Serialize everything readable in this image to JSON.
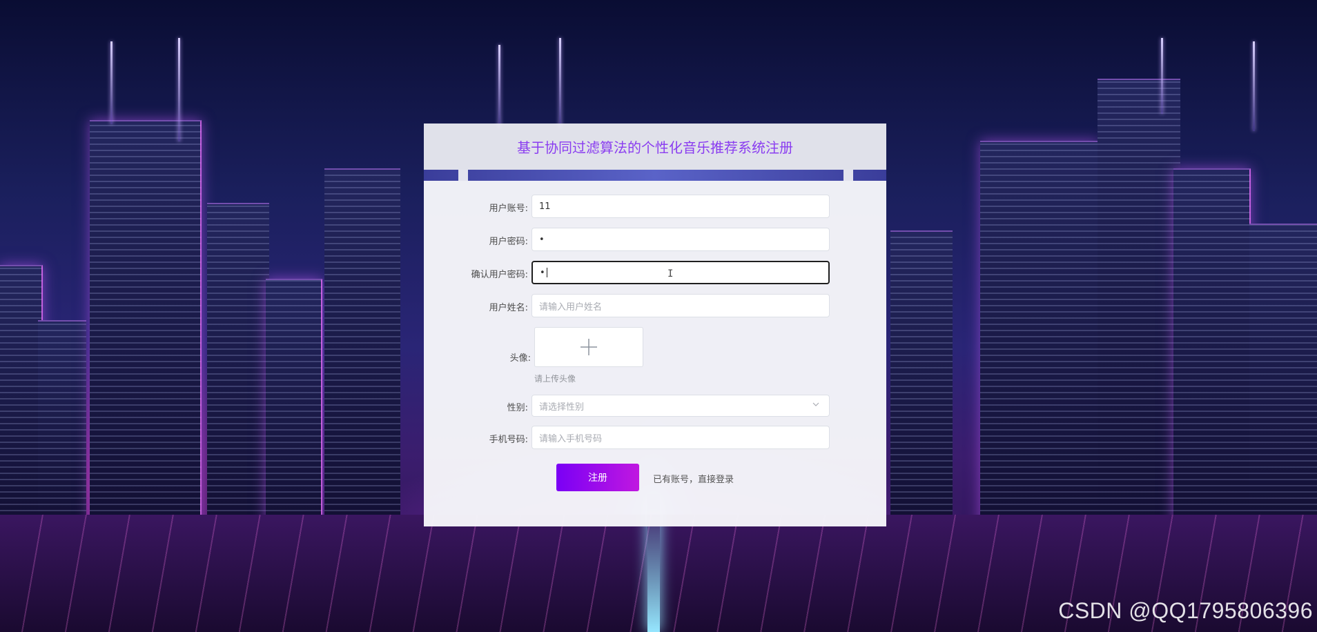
{
  "header": {
    "title": "基于协同过滤算法的个性化音乐推荐系统注册"
  },
  "form": {
    "account": {
      "label": "用户账号:",
      "value": "11"
    },
    "password": {
      "label": "用户密码:",
      "value": "•"
    },
    "confirm_password": {
      "label": "确认用户密码:",
      "value": "•"
    },
    "name": {
      "label": "用户姓名:",
      "placeholder": "请输入用户姓名"
    },
    "avatar": {
      "label": "头像:",
      "hint": "请上传头像",
      "icon": "plus-icon"
    },
    "gender": {
      "label": "性别:",
      "placeholder": "请选择性别",
      "icon": "chevron-down-icon"
    },
    "phone": {
      "label": "手机号码:",
      "placeholder": "请输入手机号码"
    },
    "submit_label": "注册",
    "login_link": "已有账号，直接登录"
  },
  "watermark": "CSDN @QQ1795806396",
  "colors": {
    "title": "#8a3df0",
    "button_start": "#7a00f5",
    "button_end": "#c018e0"
  }
}
